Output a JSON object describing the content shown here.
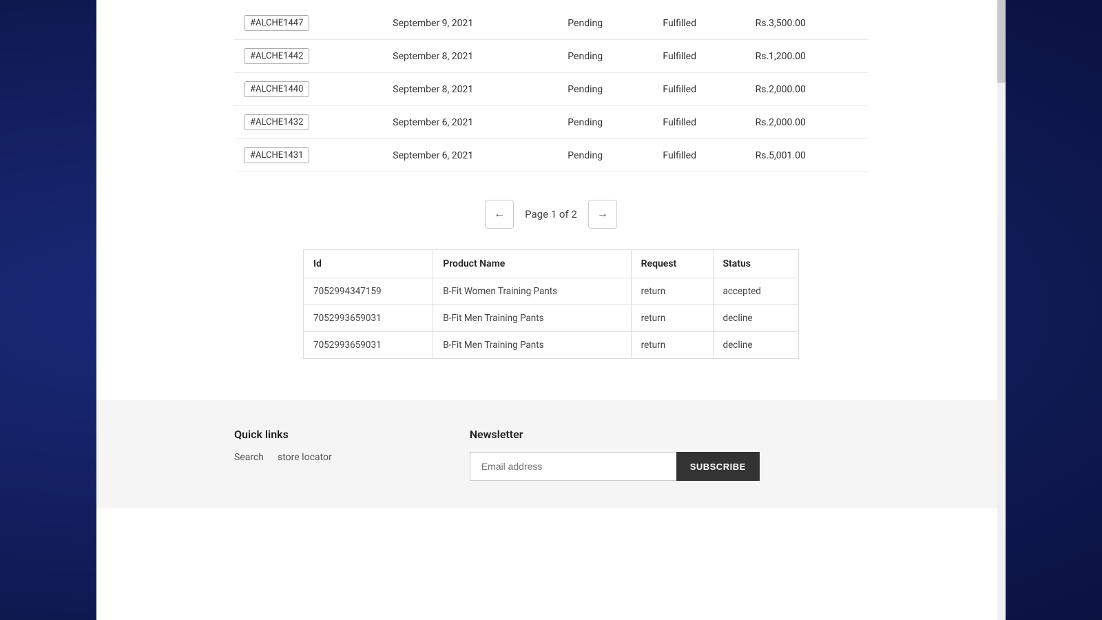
{
  "orders": {
    "rows": [
      {
        "id": "#ALCHE1447",
        "date": "September 9, 2021",
        "payment": "Pending",
        "fulfillment": "Fulfilled",
        "total": "Rs.3,500.00"
      },
      {
        "id": "#ALCHE1442",
        "date": "September 8, 2021",
        "payment": "Pending",
        "fulfillment": "Fulfilled",
        "total": "Rs.1,200.00"
      },
      {
        "id": "#ALCHE1440",
        "date": "September 8, 2021",
        "payment": "Pending",
        "fulfillment": "Fulfilled",
        "total": "Rs.2,000.00"
      },
      {
        "id": "#ALCHE1432",
        "date": "September 6, 2021",
        "payment": "Pending",
        "fulfillment": "Fulfilled",
        "total": "Rs.2,000.00"
      },
      {
        "id": "#ALCHE1431",
        "date": "September 6, 2021",
        "payment": "Pending",
        "fulfillment": "Fulfilled",
        "total": "Rs.5,001.00"
      }
    ]
  },
  "pagination": {
    "prev_arrow": "←",
    "next_arrow": "→",
    "label": "Page 1 of 2"
  },
  "returns_table": {
    "columns": [
      "Id",
      "Product Name",
      "Request",
      "Status"
    ],
    "rows": [
      {
        "id": "7052994347159",
        "product_name": "B-Fit Women Training Pants",
        "request": "return",
        "status": "accepted"
      },
      {
        "id": "7052993659031",
        "product_name": "B-Fit Men Training Pants",
        "request": "return",
        "status": "decline"
      },
      {
        "id": "7052993659031",
        "product_name": "B-Fit Men Training Pants",
        "request": "return",
        "status": "decline"
      }
    ]
  },
  "footer": {
    "quick_links_title": "Quick links",
    "links": [
      "Search",
      "store locator"
    ],
    "newsletter_title": "Newsletter",
    "email_placeholder": "Email address",
    "subscribe_label": "SUBSCRIBE"
  }
}
